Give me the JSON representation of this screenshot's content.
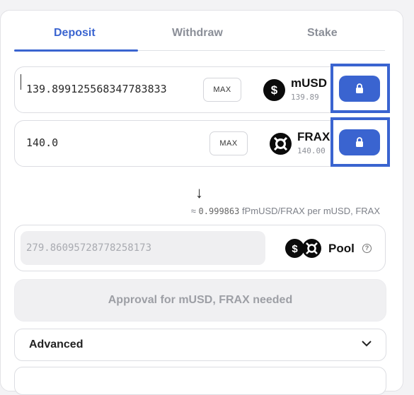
{
  "tabs": [
    {
      "label": "Deposit",
      "active": true
    },
    {
      "label": "Withdraw",
      "active": false
    },
    {
      "label": "Stake",
      "active": false
    }
  ],
  "tokens": [
    {
      "amount": "139.899125568347783833",
      "max_label": "MAX",
      "symbol": "mUSD",
      "balance": "139.89",
      "icon": "dollar-coin-icon",
      "lock_icon": "lock-icon"
    },
    {
      "amount": "140.0",
      "max_label": "MAX",
      "symbol": "FRAX",
      "balance": "140.00",
      "icon": "frax-icon",
      "lock_icon": "lock-icon"
    }
  ],
  "arrow": "↓",
  "rate": {
    "prefix": "≈",
    "value": "0.999863",
    "text": "fPmUSD/FRAX per mUSD, FRAX"
  },
  "pool": {
    "amount": "279.86095728778258173",
    "label": "Pool",
    "help_icon": "question-circle-icon"
  },
  "approval": {
    "label": "Approval for mUSD, FRAX needed"
  },
  "advanced": {
    "label": "Advanced",
    "icon": "chevron-down-icon"
  },
  "colors": {
    "accent": "#3a64d0",
    "disabled_bg": "#f0f0f2"
  }
}
